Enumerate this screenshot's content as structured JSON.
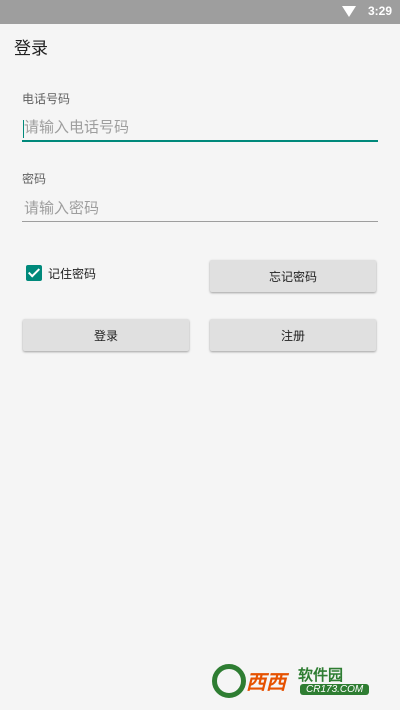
{
  "status_bar": {
    "time": "3:29"
  },
  "app_bar": {
    "title": "登录"
  },
  "form": {
    "phone_label": "电话号码",
    "phone_placeholder": "请输入电话号码",
    "phone_value": "",
    "password_label": "密码",
    "password_placeholder": "请输入密码",
    "password_value": "",
    "remember_label": "记住密码",
    "remember_checked": true,
    "forgot_button": "忘记密码",
    "login_button": "登录",
    "register_button": "注册"
  },
  "watermark": {
    "brand": "西西",
    "text": "软件园",
    "sub": "CR173.COM"
  },
  "colors": {
    "accent": "#00897b",
    "status_bar": "#9e9e9e",
    "button": "#e0e0e0"
  }
}
